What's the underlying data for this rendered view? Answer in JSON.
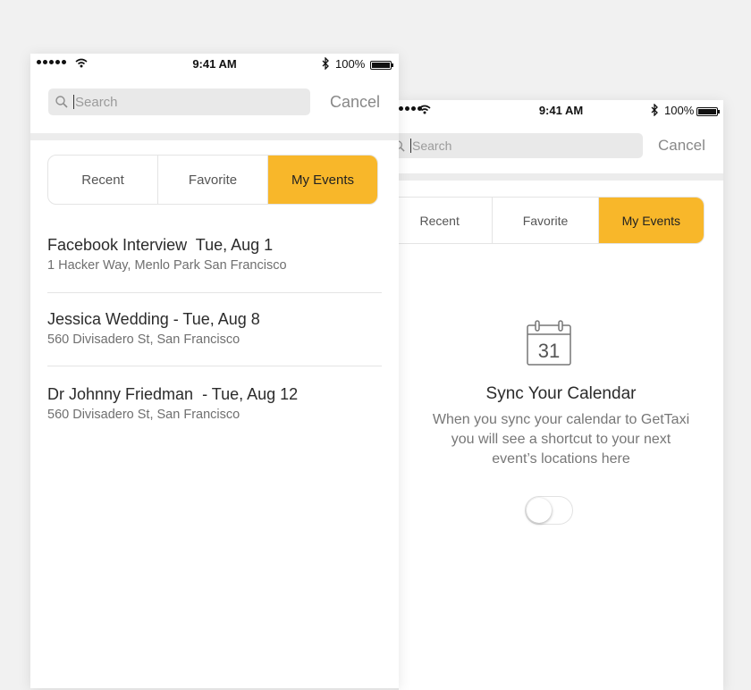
{
  "status_bar": {
    "time": "9:41 AM",
    "battery": "100%"
  },
  "search": {
    "placeholder": "Search",
    "cancel_label": "Cancel"
  },
  "tabs": [
    {
      "label": "Recent",
      "active": false
    },
    {
      "label": "Favorite",
      "active": false
    },
    {
      "label": "My Events",
      "active": true
    }
  ],
  "events": [
    {
      "title": "Facebook Interview  Tue, Aug 1",
      "address": "1 Hacker Way, Menlo Park San Francisco"
    },
    {
      "title": "Jessica Wedding - Tue, Aug 8",
      "address": "560 Divisadero St, San Francisco"
    },
    {
      "title": "Dr Johnny Friedman  - Tue, Aug 12",
      "address": "560 Divisadero St, San Francisco"
    }
  ],
  "sync": {
    "calendar_day": "31",
    "title": "Sync Your Calendar",
    "description_lines": [
      "When you sync your calendar to GetTaxi",
      "you will see a shortcut to your next",
      "event’s locations here"
    ],
    "toggle_on": false
  },
  "colors": {
    "accent": "#f8b72a",
    "background": "#f1f1f1"
  }
}
